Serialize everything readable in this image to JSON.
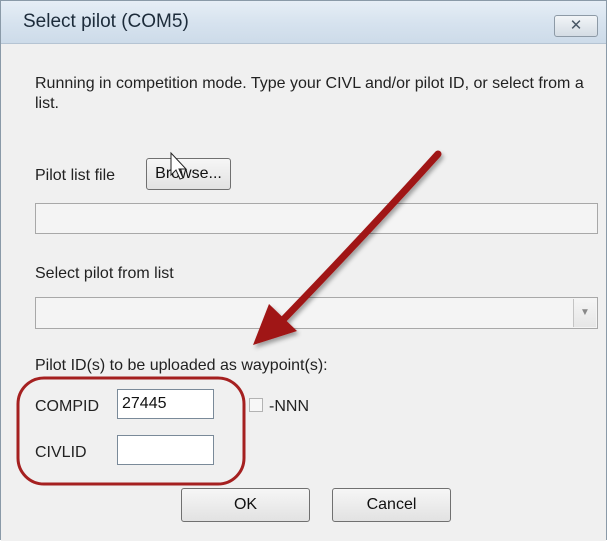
{
  "window": {
    "title": "Select pilot (COM5)",
    "close_glyph": "✕"
  },
  "intro_text": "Running in competition mode. Type your CIVL and/or pilot ID, or select from a list.",
  "pilot_list": {
    "label": "Pilot list file",
    "browse_label": "Browse...",
    "path_value": ""
  },
  "select_pilot": {
    "label": "Select pilot from list",
    "selected": ""
  },
  "upload": {
    "label": "Pilot ID(s) to be uploaded as waypoint(s):",
    "compid_label": "COMPID",
    "compid_value": "27445",
    "nnn_label": "-NNN",
    "nnn_checked": false,
    "civlid_label": "CIVLID",
    "civlid_value": ""
  },
  "buttons": {
    "ok": "OK",
    "cancel": "Cancel"
  },
  "annotation": {
    "arrow_color": "#a01414",
    "highlight_color": "#a52020"
  }
}
